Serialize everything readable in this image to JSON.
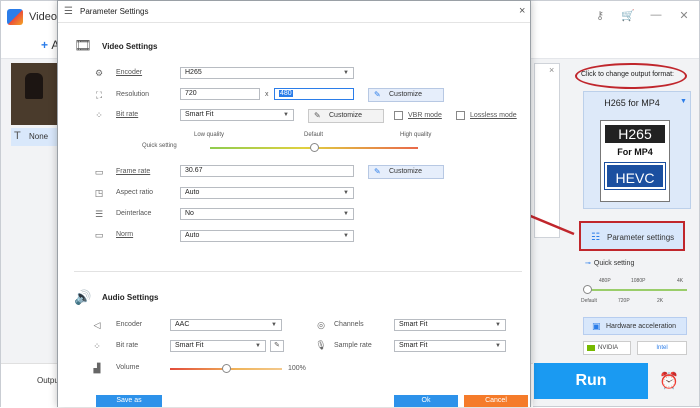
{
  "app": {
    "title": "Video",
    "add_label": "A",
    "file_name": "None",
    "output_label": "Output",
    "list_close": "×",
    "run_label": "Run"
  },
  "right_panel": {
    "hint": "Click to change output format:",
    "format_name": "H265 for MP4",
    "format_icon": {
      "top": "H265",
      "middle": "For MP4",
      "bottom": "HEVC"
    },
    "parameter_settings": "Parameter settings",
    "quick_setting": "Quick setting",
    "resolution_levels_top": [
      "480P",
      "1080P",
      "4K"
    ],
    "resolution_levels_bottom": [
      "Default",
      "720P",
      "2K"
    ],
    "hardware_acceleration": "Hardware acceleration",
    "vendors": {
      "nvidia": "NVIDIA",
      "intel": "Intel"
    }
  },
  "dialog": {
    "title": "Parameter Settings",
    "close": "×",
    "video": {
      "section_title": "Video Settings",
      "encoder_label": "Encoder",
      "encoder_value": "H265",
      "resolution_label": "Resolution",
      "resolution_width": "720",
      "resolution_x": "x",
      "resolution_height": "480",
      "bitrate_label": "Bit rate",
      "bitrate_value": "Smart Fit",
      "vbr_label": "VBR mode",
      "lossless_label": "Lossless mode",
      "quick_setting_label": "Quick setting",
      "quality_low": "Low quality",
      "quality_default": "Default",
      "quality_high": "High quality",
      "quality_level": 0.5,
      "framerate_label": "Frame rate",
      "framerate_value": "30.67",
      "aspect_label": "Aspect ratio",
      "aspect_value": "Auto",
      "deinterlace_label": "Deinterlace",
      "deinterlace_value": "No",
      "norm_label": "Norm",
      "norm_value": "Auto",
      "customize_label": "Customize"
    },
    "audio": {
      "section_title": "Audio Settings",
      "encoder_label": "Encoder",
      "encoder_value": "AAC",
      "channels_label": "Channels",
      "channels_value": "Smart Fit",
      "bitrate_label": "Bit rate",
      "bitrate_value": "Smart Fit",
      "samplerate_label": "Sample rate",
      "samplerate_value": "Smart Fit",
      "volume_label": "Volume",
      "volume_value": "100%"
    },
    "footer": {
      "save_as": "Save as",
      "ok": "Ok",
      "cancel": "Cancel"
    }
  },
  "colors": {
    "accent": "#2d92ea",
    "annotation": "#c0262c",
    "cancel": "#f57b2a",
    "run": "#1a9af2"
  }
}
